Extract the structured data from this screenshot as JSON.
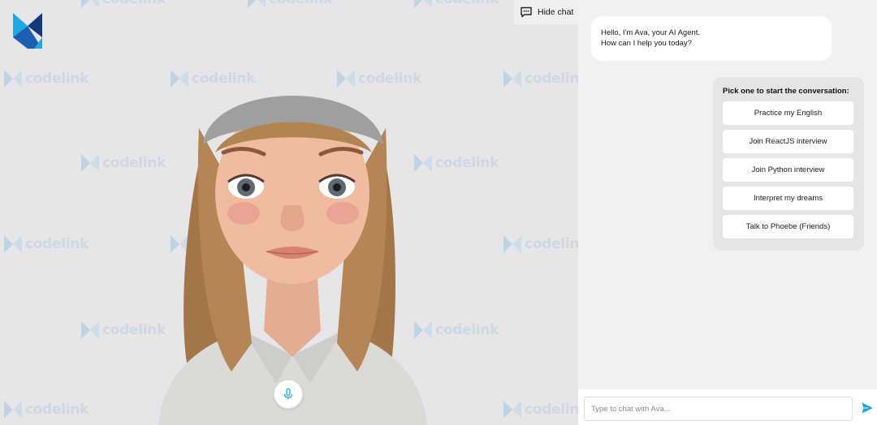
{
  "brand": {
    "watermark_text": "codelink",
    "logo_icon": "codelink-logo-icon"
  },
  "stage": {
    "mic_icon": "microphone-icon"
  },
  "header": {
    "hide_chat_label": "Hide chat",
    "hide_chat_icon": "chat-bubble-icon"
  },
  "chat": {
    "ai_message": {
      "line1": "Hello, I'm Ava, your AI Agent.",
      "line2": "How can I help you today?"
    },
    "options": {
      "title": "Pick one to start the conversation:",
      "items": [
        {
          "label": "Practice my English"
        },
        {
          "label": "Join ReactJS interview"
        },
        {
          "label": "Join Python interview"
        },
        {
          "label": "Interpret my dreams"
        },
        {
          "label": "Talk to Phoebe (Friends)"
        }
      ]
    },
    "input": {
      "placeholder": "Type to chat with Ava...",
      "value": ""
    },
    "send_icon": "send-icon"
  },
  "colors": {
    "accent": "#1ea0e0",
    "logo_dark": "#123a7a",
    "logo_light": "#1fa9dc"
  }
}
